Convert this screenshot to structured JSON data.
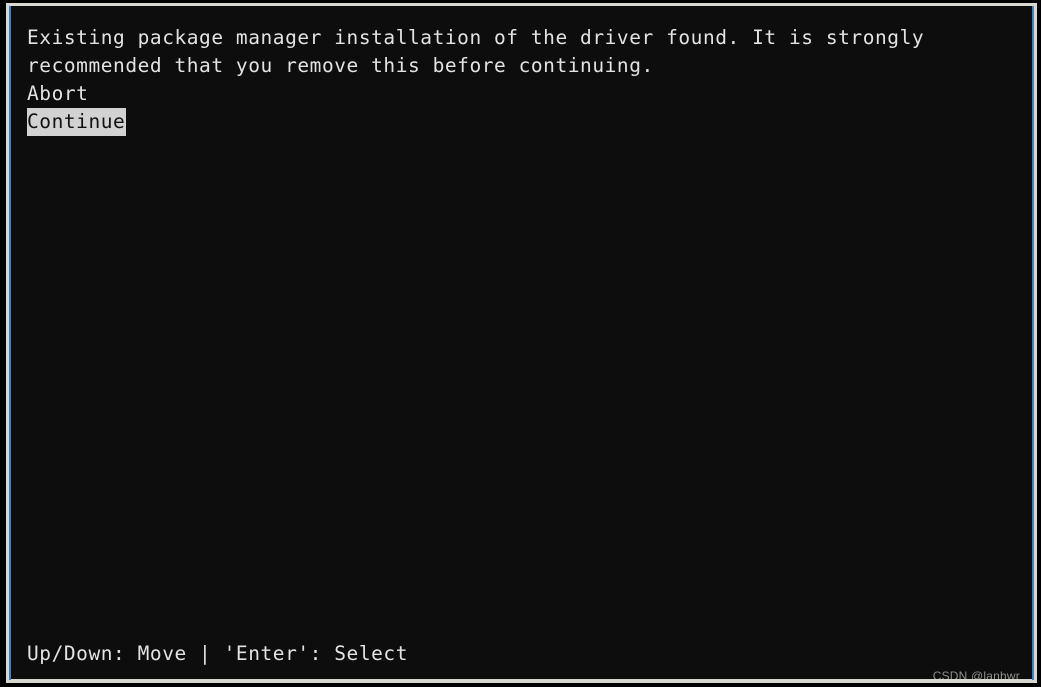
{
  "terminal": {
    "background_color": "#0d0d0d",
    "text_color": "#e2e2e2",
    "frame_color": "#d8d7cf",
    "frame_accent_color": "#3f80c4",
    "highlight_background": "#d2d2d2",
    "highlight_text_color": "#111111",
    "message": {
      "line1": "Existing package manager installation of the driver found. It is strongly",
      "line2": "recommended that you remove this before continuing."
    },
    "menu": {
      "items": [
        {
          "label": "Abort",
          "selected": false
        },
        {
          "label": "Continue",
          "selected": true
        }
      ]
    },
    "statusbar": {
      "hint": "Up/Down: Move | 'Enter': Select"
    }
  },
  "watermark": {
    "text": "CSDN @lanhwr",
    "color": "#8e8e8e"
  }
}
